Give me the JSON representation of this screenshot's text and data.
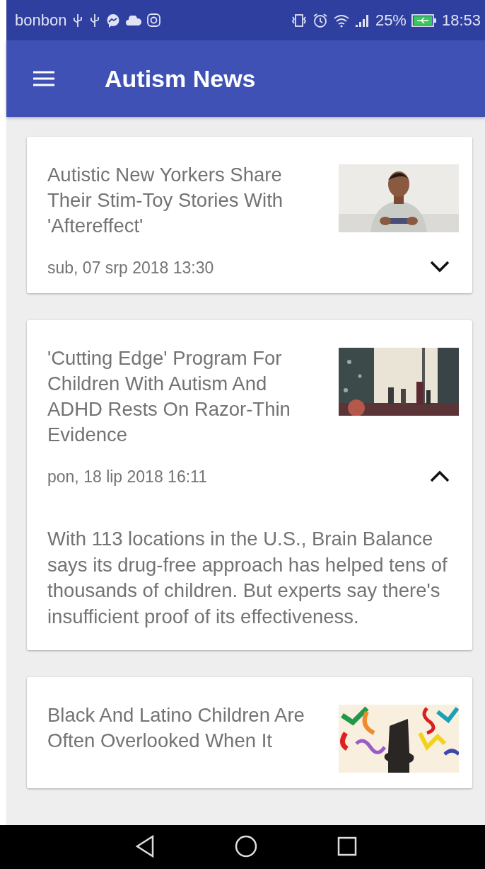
{
  "status_bar": {
    "carrier": "bonbon",
    "battery": "25%",
    "time": "18:53"
  },
  "app_bar": {
    "title": "Autism News"
  },
  "articles": [
    {
      "title": "Autistic New Yorkers Share Their Stim-Toy Stories With 'Aftereffect'",
      "date": "sub, 07 srp 2018 13:30",
      "expanded": false
    },
    {
      "title": "'Cutting Edge' Program For Children With Autism And ADHD Rests On Razor-Thin Evidence",
      "date": "pon, 18 lip 2018 16:11",
      "expanded": true,
      "description": "With 113 locations in the U.S., Brain Balance says its drug-free approach has helped tens of thousands of children. But experts say there's insufficient proof of its effectiveness."
    },
    {
      "title": "Black And Latino Children Are Often Overlooked When It"
    }
  ]
}
